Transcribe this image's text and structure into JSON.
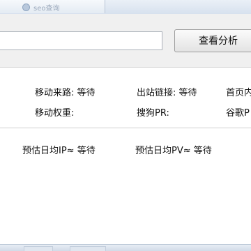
{
  "tab": {
    "label": "seo查询"
  },
  "toolbar": {
    "url_value": "",
    "query_button_label": "查看分析"
  },
  "stats": {
    "mobile_source": "移动来路: 等待",
    "outbound_links": "出站链接: 等待",
    "homepage_partial": "首页内",
    "mobile_weight": "移动权重:",
    "sogou_pr": "搜狗PR:",
    "google_partial": "谷歌P",
    "est_daily_ip": "预估日均IP≈ 等待",
    "est_daily_pv": "预估日均PV≈ 等待"
  }
}
